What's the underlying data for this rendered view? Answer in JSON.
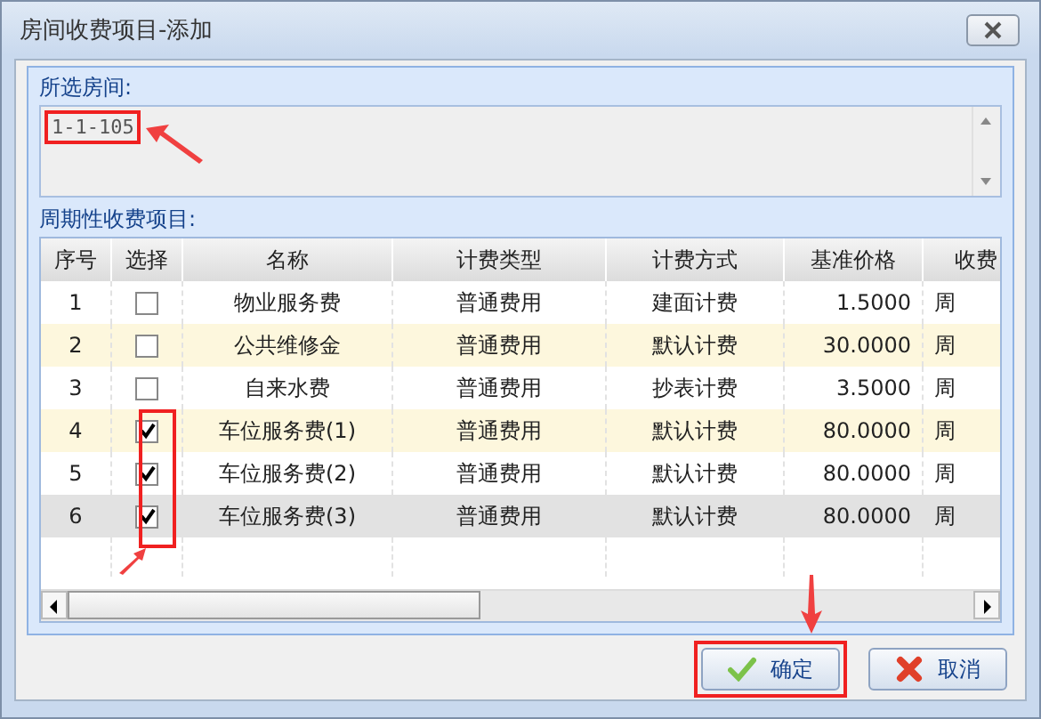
{
  "window": {
    "title": "房间收费项目-添加"
  },
  "room": {
    "label": "所选房间:",
    "value": "1-1-105",
    "highlighted": true
  },
  "items_label": "周期性收费项目:",
  "table": {
    "columns": [
      "序号",
      "选择",
      "名称",
      "计费类型",
      "计费方式",
      "基准价格",
      "收费"
    ],
    "rows": [
      {
        "no": "1",
        "checked": false,
        "name": "物业服务费",
        "type": "普通费用",
        "method": "建面计费",
        "price": "1.5000",
        "column_7": "周",
        "selected": false
      },
      {
        "no": "2",
        "checked": false,
        "name": "公共维修金",
        "type": "普通费用",
        "method": "默认计费",
        "price": "30.0000",
        "column_7": "周",
        "selected": false
      },
      {
        "no": "3",
        "checked": false,
        "name": "自来水费",
        "type": "普通费用",
        "method": "抄表计费",
        "price": "3.5000",
        "column_7": "周",
        "selected": false
      },
      {
        "no": "4",
        "checked": true,
        "name": "车位服务费(1)",
        "type": "普通费用",
        "method": "默认计费",
        "price": "80.0000",
        "column_7": "周",
        "selected": false
      },
      {
        "no": "5",
        "checked": true,
        "name": "车位服务费(2)",
        "type": "普通费用",
        "method": "默认计费",
        "price": "80.0000",
        "column_7": "周",
        "selected": false
      },
      {
        "no": "6",
        "checked": true,
        "name": "车位服务费(3)",
        "type": "普通费用",
        "method": "默认计费",
        "price": "80.0000",
        "column_7": "周",
        "selected": true
      }
    ]
  },
  "buttons": [
    {
      "label": "确定",
      "kind": "ok",
      "highlighted": true
    },
    {
      "label": "取消",
      "kind": "cancel",
      "highlighted": false
    }
  ]
}
